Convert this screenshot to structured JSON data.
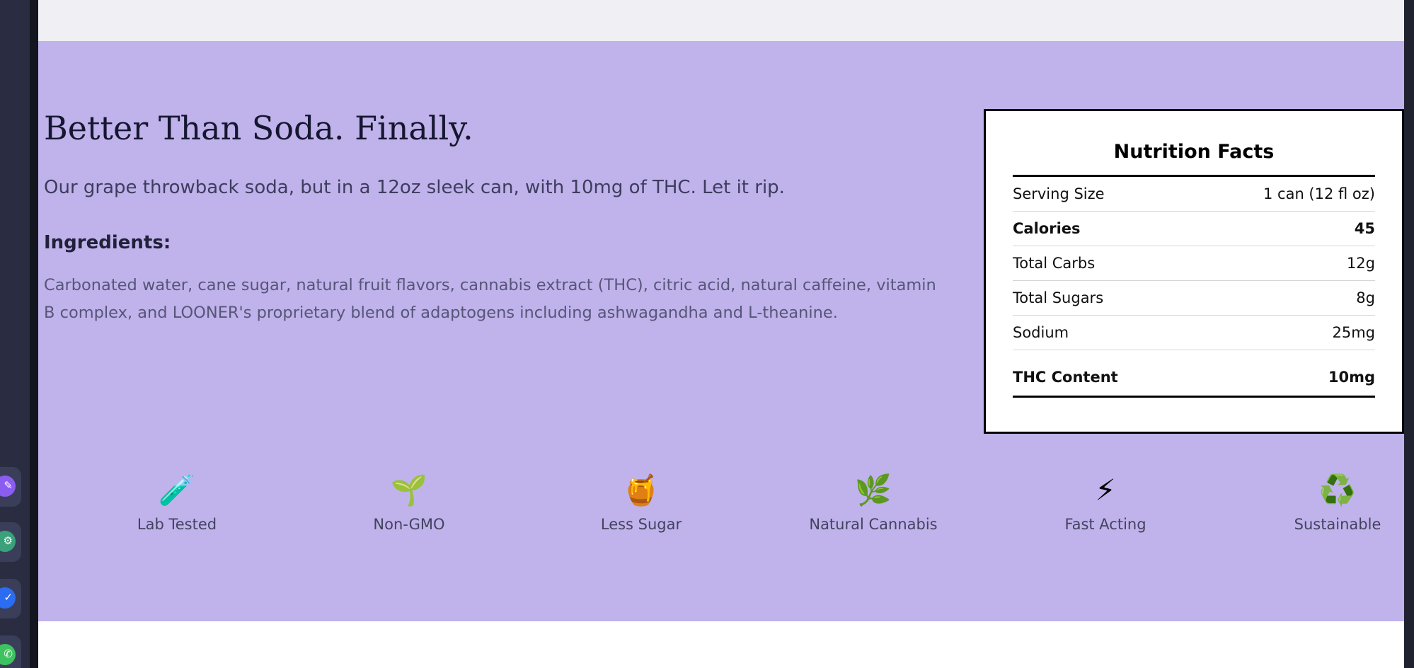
{
  "hero": {
    "headline": "Better Than Soda. Finally.",
    "tagline": "Our grape throwback soda, but in a 12oz sleek can, with 10mg of THC. Let it rip.",
    "ingredients_title": "Ingredients:",
    "ingredients_text": "Carbonated water, cane sugar, natural fruit flavors, cannabis extract (THC), citric acid, natural caffeine, vitamin B complex, and LOONER's proprietary blend of adaptogens including ashwagandha and L-theanine."
  },
  "nutrition": {
    "title": "Nutrition Facts",
    "rows": [
      {
        "label": "Serving Size",
        "value": "1 can (12 fl oz)"
      },
      {
        "label": "Calories",
        "value": "45"
      },
      {
        "label": "Total Carbs",
        "value": "12g"
      },
      {
        "label": "Total Sugars",
        "value": "8g"
      },
      {
        "label": "Sodium",
        "value": "25mg"
      },
      {
        "label": "THC Content",
        "value": "10mg"
      }
    ]
  },
  "features": [
    {
      "icon": "🧪",
      "icon_name": "test-tube-icon",
      "label": "Lab Tested"
    },
    {
      "icon": "🌱",
      "icon_name": "seedling-icon",
      "label": "Non-GMO"
    },
    {
      "icon": "🍯",
      "icon_name": "honey-pot-icon",
      "label": "Less Sugar"
    },
    {
      "icon": "🌿",
      "icon_name": "herb-icon",
      "label": "Natural Cannabis"
    },
    {
      "icon": "⚡",
      "icon_name": "lightning-icon",
      "label": "Fast Acting"
    },
    {
      "icon": "♻️",
      "icon_name": "recycle-icon",
      "label": "Sustainable"
    }
  ],
  "dock": {
    "apps": [
      {
        "icon_name": "pen-app-icon",
        "glyph": "✎",
        "color": "#8a5cf0"
      },
      {
        "icon_name": "chatgpt-app-icon",
        "glyph": "⚙",
        "color": "#3aa17a"
      },
      {
        "icon_name": "messenger-app-icon",
        "glyph": "✓",
        "color": "#2b6cf0"
      },
      {
        "icon_name": "whatsapp-app-icon",
        "glyph": "✆",
        "color": "#3ec25f"
      }
    ]
  },
  "colors": {
    "hero_bg": "#c0b2ea",
    "top_strip": "#efeff4",
    "dock_bg": "#2a2d42"
  }
}
